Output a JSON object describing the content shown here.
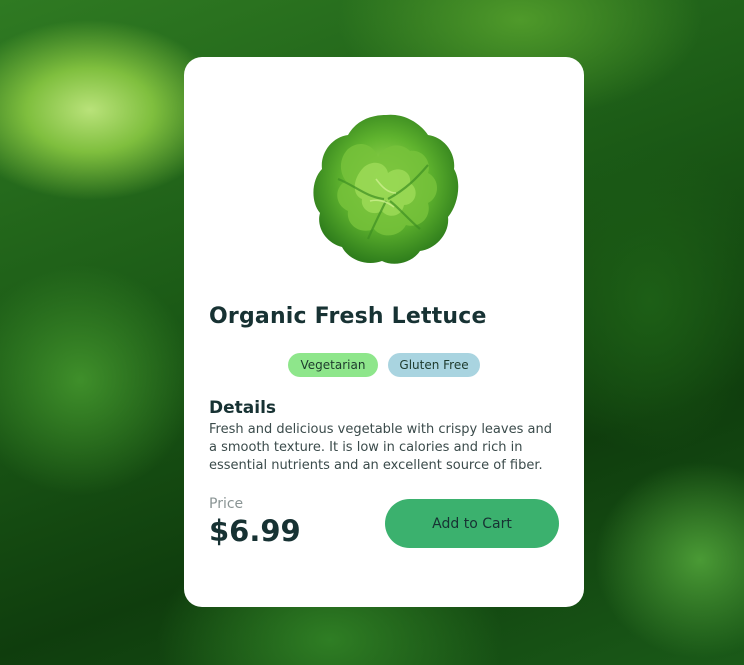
{
  "product": {
    "title": "Organic Fresh Lettuce",
    "image_icon": "lettuce-image",
    "tags": [
      "Vegetarian",
      "Gluten Free"
    ],
    "details_heading": "Details",
    "details_text": "Fresh and delicious vegetable with crispy leaves and a smooth texture. It is low in calories and rich in essential nutrients and an excellent source of fiber.",
    "price_label": "Price",
    "price": "$6.99",
    "cta_label": "Add to Cart"
  },
  "colors": {
    "card_bg": "#ffffff",
    "title": "#173233",
    "tag_vegetarian": "#8ee68b",
    "tag_gluten_free": "#a9d4e0",
    "cta_bg": "#3bb16e"
  }
}
